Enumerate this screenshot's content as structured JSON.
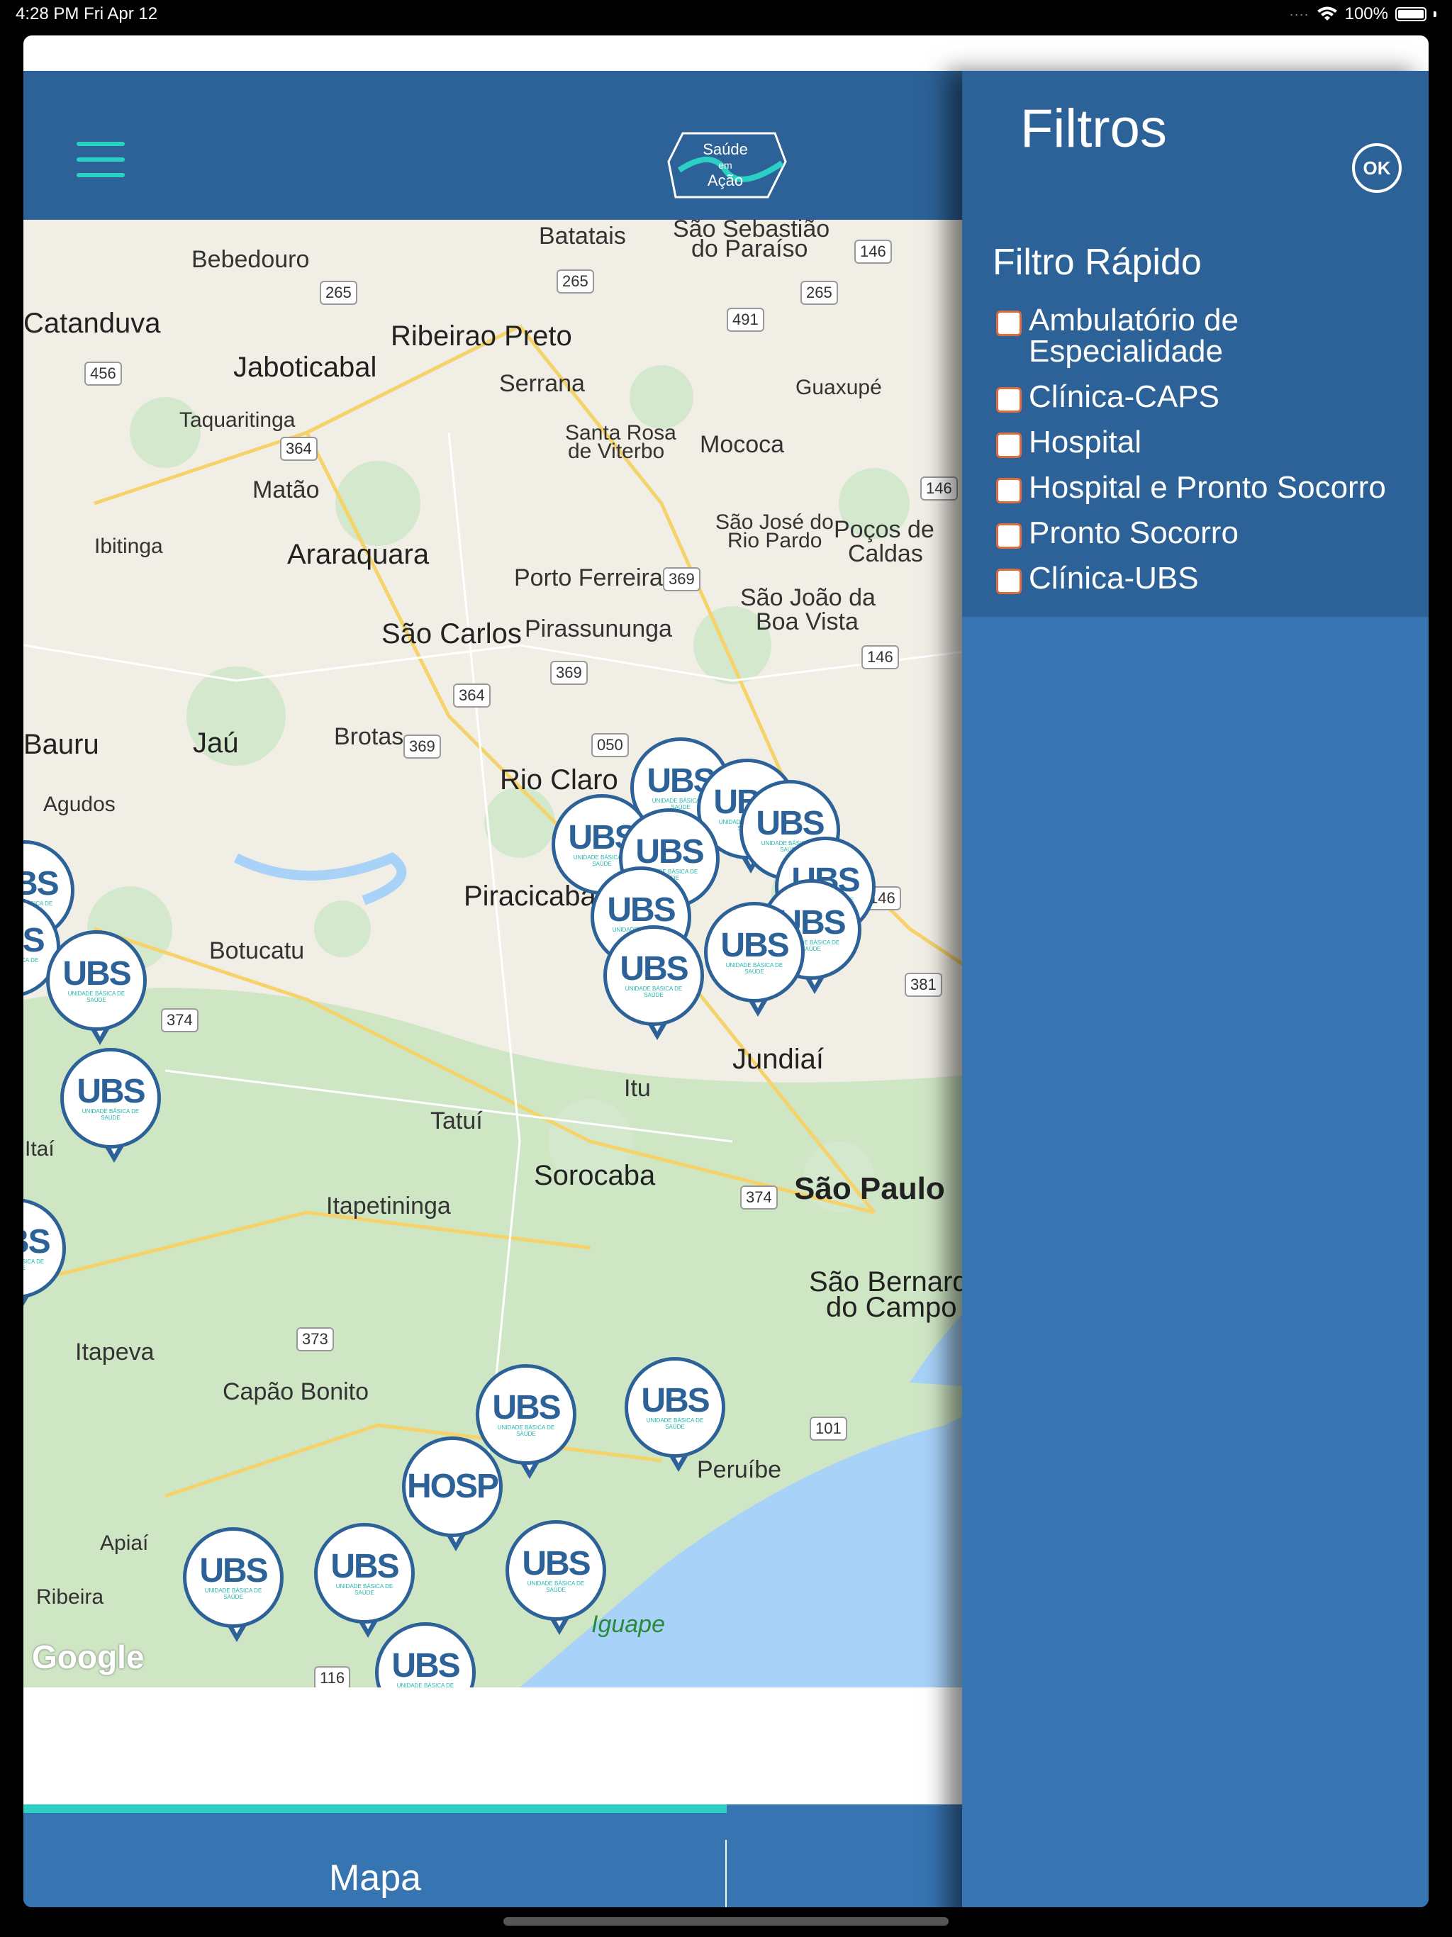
{
  "status_bar": {
    "time": "4:28 PM   Fri Apr 12",
    "battery": "100%"
  },
  "header": {
    "logo_text_line1": "Saúde",
    "logo_text_line2": "em",
    "logo_text_line3": "Ação"
  },
  "map": {
    "attribution": "Google",
    "cities": [
      {
        "name": "Batatais"
      },
      {
        "name": "São Sebastião"
      },
      {
        "name": "do Paraíso"
      },
      {
        "name": "Bebedouro"
      },
      {
        "name": "Catanduva"
      },
      {
        "name": "Ribeirao Preto"
      },
      {
        "name": "Jaboticabal"
      },
      {
        "name": "Serrana"
      },
      {
        "name": "Guaxupé"
      },
      {
        "name": "Taquaritinga"
      },
      {
        "name": "Santa Rosa"
      },
      {
        "name": "de Viterbo"
      },
      {
        "name": "Mococa"
      },
      {
        "name": "Matão"
      },
      {
        "name": "Ibitinga"
      },
      {
        "name": "Araraquara"
      },
      {
        "name": "São José do"
      },
      {
        "name": "Rio Pardo"
      },
      {
        "name": "Poços de"
      },
      {
        "name": "Caldas"
      },
      {
        "name": "Porto Ferreira"
      },
      {
        "name": "São João da"
      },
      {
        "name": "Boa Vista"
      },
      {
        "name": "São Carlos"
      },
      {
        "name": "Pirassununga"
      },
      {
        "name": "Bauru"
      },
      {
        "name": "Jaú"
      },
      {
        "name": "Brotas"
      },
      {
        "name": "Rio Claro"
      },
      {
        "name": "Agudos"
      },
      {
        "name": "Piracicaba"
      },
      {
        "name": "Botucatu"
      },
      {
        "name": "Jundiaí"
      },
      {
        "name": "Itu"
      },
      {
        "name": "Tatuí"
      },
      {
        "name": "Sorocaba"
      },
      {
        "name": "São Paulo"
      },
      {
        "name": "Itapetininga"
      },
      {
        "name": "São Bernardo"
      },
      {
        "name": "do Campo"
      },
      {
        "name": "Itapeva"
      },
      {
        "name": "Capão Bonito"
      },
      {
        "name": "Peruíbe"
      },
      {
        "name": "Apiaí"
      },
      {
        "name": "Ribeira"
      },
      {
        "name": "Itaí"
      },
      {
        "name": "Iguape"
      }
    ],
    "routes": [
      "265",
      "265",
      "146",
      "265",
      "491",
      "456",
      "364",
      "146",
      "369",
      "146",
      "364",
      "369",
      "369",
      "050",
      "146",
      "374",
      "381",
      "374",
      "373",
      "101",
      "116"
    ],
    "pins": [
      {
        "kind": "UBS"
      },
      {
        "kind": "UBS"
      },
      {
        "kind": "UBS"
      },
      {
        "kind": "UBS"
      },
      {
        "kind": "UBS"
      },
      {
        "kind": "UBS"
      },
      {
        "kind": "UBS"
      },
      {
        "kind": "UBS"
      },
      {
        "kind": "UBS"
      },
      {
        "kind": "UBS"
      },
      {
        "kind": "UBS"
      },
      {
        "kind": "UBS"
      },
      {
        "kind": "UBS"
      },
      {
        "kind": "UBS"
      },
      {
        "kind": "UBS"
      },
      {
        "kind": "UBS"
      },
      {
        "kind": "HOSP"
      },
      {
        "kind": "UBS"
      },
      {
        "kind": "UBS"
      },
      {
        "kind": "UBS"
      },
      {
        "kind": "UBS"
      },
      {
        "kind": "UBS"
      }
    ],
    "pin_subtitle": "UNIDADE BÁSICA DE SAÚDE"
  },
  "tabs": {
    "map_label": "Mapa"
  },
  "filters": {
    "title": "Filtros",
    "ok_label": "OK",
    "quick_title": "Filtro Rápido",
    "items": [
      {
        "label": "Ambulatório de Especialidade",
        "checked": false
      },
      {
        "label": "Clínica-CAPS",
        "checked": false
      },
      {
        "label": "Hospital",
        "checked": false
      },
      {
        "label": "Hospital e Pronto Socorro",
        "checked": false
      },
      {
        "label": "Pronto Socorro",
        "checked": false
      },
      {
        "label": "Clínica-UBS",
        "checked": false
      }
    ]
  },
  "colors": {
    "header": "#2c6297",
    "accent": "#2bd0c4",
    "panel": "#3774b2",
    "checkbox_border": "#e06a3a"
  }
}
